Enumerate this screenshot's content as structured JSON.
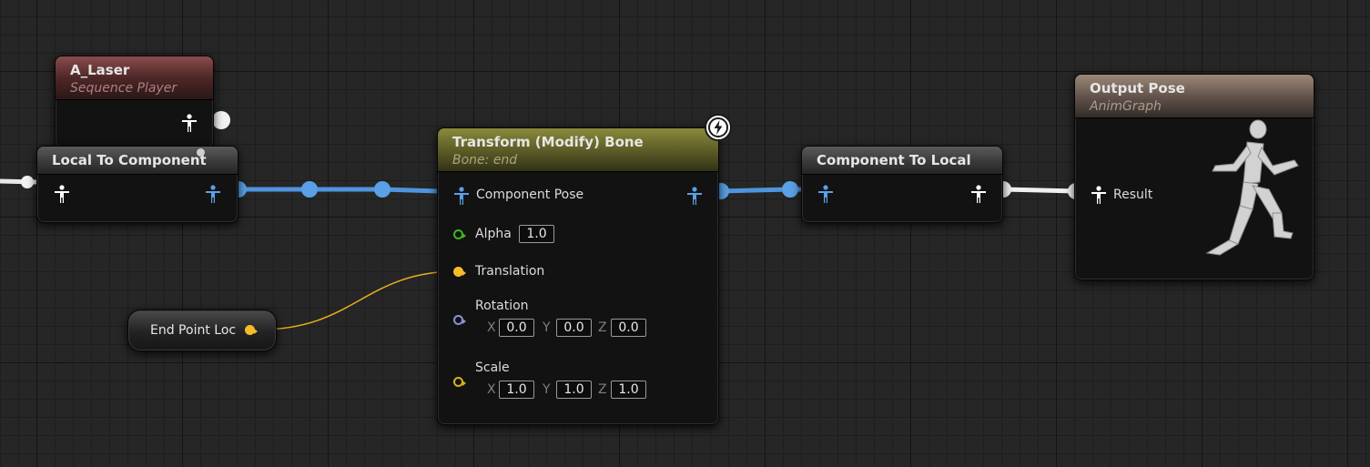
{
  "nodes": {
    "sequence_player": {
      "title": "A_Laser",
      "subtitle": "Sequence Player"
    },
    "local_to_component": {
      "title": "Local To Component"
    },
    "transform_modify_bone": {
      "title": "Transform (Modify) Bone",
      "subtitle": "Bone: end",
      "pins": {
        "component_pose": "Component Pose",
        "alpha_label": "Alpha",
        "alpha_value": "1.0",
        "translation": "Translation",
        "rotation": "Rotation",
        "rotation_values": {
          "x": "0.0",
          "y": "0.0",
          "z": "0.0"
        },
        "scale": "Scale",
        "scale_values": {
          "x": "1.0",
          "y": "1.0",
          "z": "1.0"
        },
        "axis_labels": {
          "x": "X",
          "y": "Y",
          "z": "Z"
        }
      }
    },
    "component_to_local": {
      "title": "Component To Local"
    },
    "output_pose": {
      "title": "Output Pose",
      "subtitle": "AnimGraph",
      "pins": {
        "result": "Result"
      }
    },
    "variable_get": {
      "label": "End Point Loc"
    }
  },
  "colors": {
    "pose_pin": "#5aa0e6",
    "wire_pose": "#4f94dc",
    "wire_local": "#ffffff",
    "vector_pin": "#f5bc2a",
    "float_pin": "#3cb81e",
    "rotator_pin": "#8a92d6",
    "scale_pin": "#d9b020"
  },
  "icons": {
    "pose": "pose-person-icon",
    "fast_path": "lightning-bolt-icon",
    "preview": "mannequin-running-icon"
  }
}
